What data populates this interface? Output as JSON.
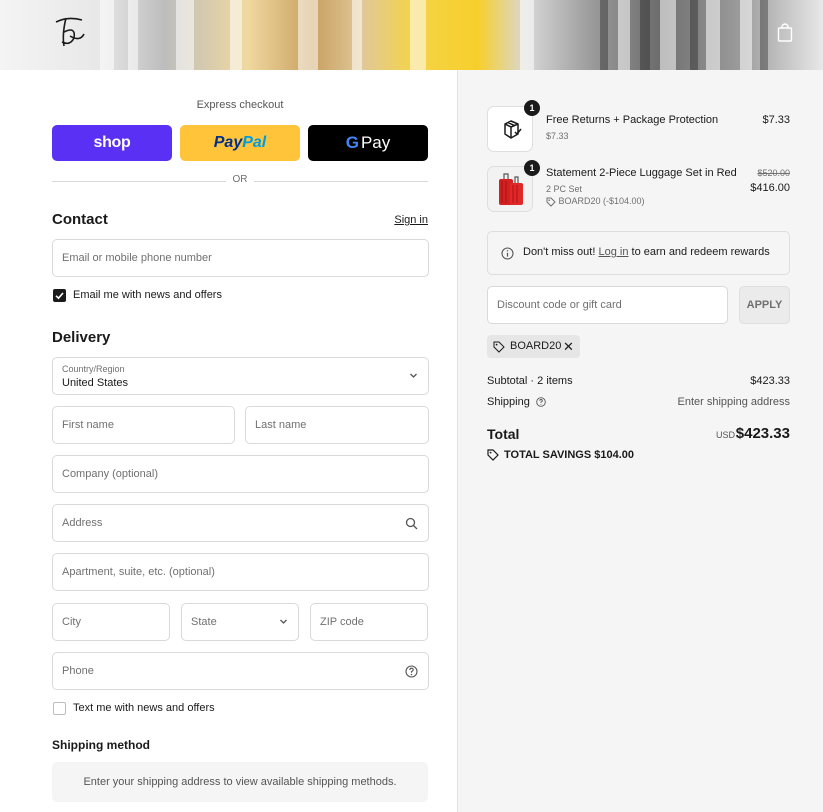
{
  "banner": {
    "logo_icon": "signature-logo-icon",
    "bag_icon": "shopping-bag-icon"
  },
  "express": {
    "label": "Express checkout",
    "shop_label": "shop",
    "paypal_part1": "Pay",
    "paypal_part2": "Pal",
    "gpay_g": "G",
    "gpay_label": "Pay",
    "or_label": "OR"
  },
  "contact": {
    "title": "Contact",
    "signin_label": "Sign in",
    "email_placeholder": "Email or mobile phone number",
    "email_news_label": "Email me with news and offers",
    "email_news_checked": true
  },
  "delivery": {
    "title": "Delivery",
    "country_label": "Country/Region",
    "country_value": "United States",
    "first_name_placeholder": "First name",
    "last_name_placeholder": "Last name",
    "company_placeholder": "Company (optional)",
    "address_placeholder": "Address",
    "apartment_placeholder": "Apartment, suite, etc. (optional)",
    "city_placeholder": "City",
    "state_placeholder": "State",
    "zip_placeholder": "ZIP code",
    "phone_placeholder": "Phone",
    "text_news_label": "Text me with news and offers",
    "text_news_checked": false
  },
  "shipping": {
    "title": "Shipping method",
    "message": "Enter your shipping address to view available shipping methods."
  },
  "summary": {
    "items": [
      {
        "qty": "1",
        "title": "Free Returns + Package Protection",
        "subtitle": "$7.33",
        "price": "$7.33",
        "icon": "package-icon"
      },
      {
        "qty": "1",
        "title": "Statement 2-Piece Luggage Set in Red",
        "subtitle": "2 PC Set",
        "discount": "BOARD20 (-$104.00)",
        "original_price": "$520.00",
        "price": "$416.00",
        "icon": "luggage-icon"
      }
    ],
    "rewards_prefix": "Don't miss out!",
    "rewards_link": "Log in",
    "rewards_suffix": "to earn and redeem rewards",
    "discount_placeholder": "Discount code or gift card",
    "apply_label": "APPLY",
    "applied_code": "BOARD20",
    "subtotal_label": "Subtotal · 2 items",
    "subtotal_value": "$423.33",
    "shipping_label": "Shipping",
    "shipping_value": "Enter shipping address",
    "total_label": "Total",
    "currency": "USD",
    "total_value": "$423.33",
    "savings_label": "TOTAL SAVINGS",
    "savings_value": "$104.00"
  },
  "colors": {
    "shop": "#5a31f4",
    "paypal": "#ffc439",
    "gpay": "#000000",
    "summary_bg": "#f5f5f5"
  }
}
